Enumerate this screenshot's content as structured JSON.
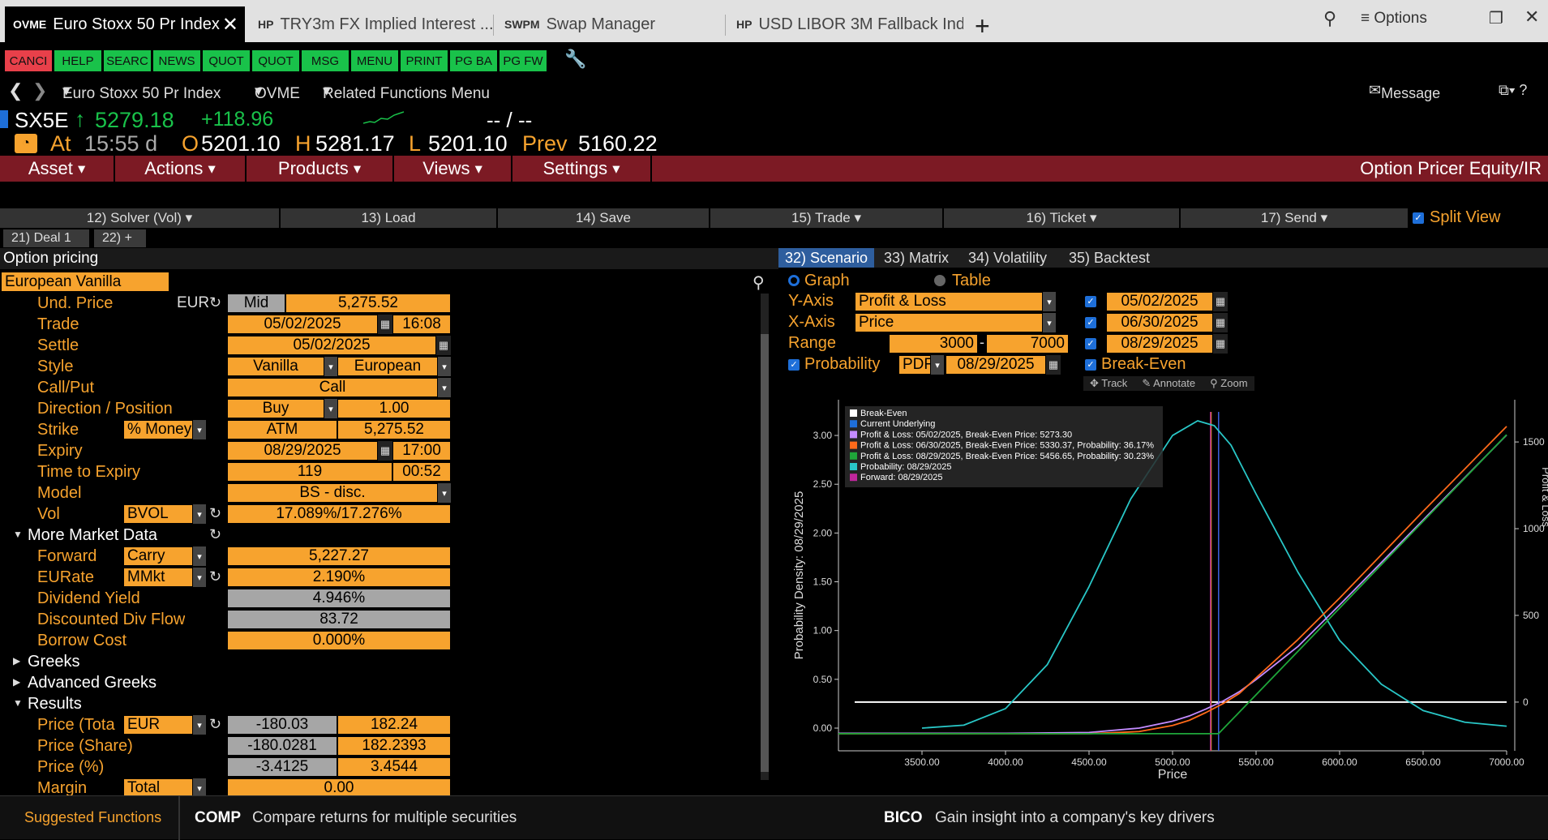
{
  "tabs": [
    {
      "code": "OVME",
      "title": "Euro Stoxx 50 Pr Index",
      "active": true
    },
    {
      "code": "HP",
      "title": "TRY3m FX Implied Interest ..."
    },
    {
      "code": "SWPM",
      "title": "Swap Manager"
    },
    {
      "code": "HP",
      "title": "USD LIBOR 3M Fallback Ind..."
    }
  ],
  "window": {
    "options_label": "Options",
    "new_tab": "+"
  },
  "function_keys": [
    {
      "label": "CANCI",
      "color": "#e8404a"
    },
    {
      "label": "HELP",
      "color": "#19c24a"
    },
    {
      "label": "SEARC",
      "color": "#19c24a"
    },
    {
      "label": "NEWS",
      "color": "#19c24a"
    },
    {
      "label": "QUOT",
      "color": "#19c24a"
    },
    {
      "label": "QUOT",
      "color": "#19c24a"
    },
    {
      "label": "MSG",
      "color": "#19c24a"
    },
    {
      "label": "MENU",
      "color": "#19c24a"
    },
    {
      "label": "PRINT",
      "color": "#19c24a"
    },
    {
      "label": "PG BA",
      "color": "#19c24a"
    },
    {
      "label": "PG FW",
      "color": "#19c24a"
    }
  ],
  "nav": {
    "security": "Euro Stoxx 50 Pr Index",
    "function": "OVME",
    "related": "Related Functions Menu",
    "message": "Message"
  },
  "quote": {
    "ticker": "SX5E",
    "last": "5279.18",
    "change": "+118.96",
    "bidask": "-- / --",
    "at_label": "At",
    "time": "15:55 d",
    "open_label": "O",
    "open": "5201.10",
    "high_label": "H",
    "high": "5281.17",
    "low_label": "L",
    "low": "5201.10",
    "prev_label": "Prev",
    "prev": "5160.22"
  },
  "menubar": {
    "items": [
      "Asset",
      "Actions",
      "Products",
      "Views",
      "Settings"
    ],
    "title": "Option Pricer Equity/IR"
  },
  "actions": [
    "12) Solver (Vol)",
    "13) Load",
    "14) Save",
    "15) Trade",
    "16) Ticket",
    "17) Send"
  ],
  "split_view": "Split View",
  "deal_tabs": [
    "21) Deal 1",
    "22) +"
  ],
  "left": {
    "section": "Option pricing",
    "product": "European Vanilla",
    "und_price": {
      "label": "Und. Price",
      "ccy": "EUR",
      "side": "Mid",
      "value": "5,275.52"
    },
    "trade": {
      "label": "Trade",
      "date": "05/02/2025",
      "time": "16:08"
    },
    "settle": {
      "label": "Settle",
      "date": "05/02/2025"
    },
    "style": {
      "label": "Style",
      "a": "Vanilla",
      "b": "European"
    },
    "callput": {
      "label": "Call/Put",
      "value": "Call"
    },
    "direction": {
      "label": "Direction / Position",
      "a": "Buy",
      "b": "1.00"
    },
    "strike": {
      "label": "Strike",
      "mode": "% Money",
      "a": "ATM",
      "b": "5,275.52"
    },
    "expiry": {
      "label": "Expiry",
      "date": "08/29/2025",
      "time": "17:00"
    },
    "tte": {
      "label": "Time to Expiry",
      "days": "119",
      "time": "00:52"
    },
    "model": {
      "label": "Model",
      "value": "BS - disc."
    },
    "vol": {
      "label": "Vol",
      "source": "BVOL",
      "value": "17.089%/17.276%"
    },
    "more": "More Market Data",
    "forward": {
      "label": "Forward",
      "mode": "Carry",
      "value": "5,227.27"
    },
    "eurate": {
      "label": "EURate",
      "mode": "MMkt",
      "value": "2.190%"
    },
    "divyield": {
      "label": "Dividend Yield",
      "value": "4.946%"
    },
    "divflow": {
      "label": "Discounted Div Flow",
      "value": "83.72"
    },
    "borrow": {
      "label": "Borrow Cost",
      "value": "0.000%"
    },
    "greeks": "Greeks",
    "adv_greeks": "Advanced Greeks",
    "results": "Results",
    "price_total": {
      "label": "Price (Tota",
      "ccy": "EUR",
      "a": "-180.03",
      "b": "182.24"
    },
    "price_share": {
      "label": "Price (Share)",
      "a": "-180.0281",
      "b": "182.2393"
    },
    "price_pct": {
      "label": "Price (%)",
      "a": "-3.4125",
      "b": "3.4544"
    },
    "margin": {
      "label": "Margin",
      "mode": "Total",
      "value": "0.00"
    }
  },
  "right": {
    "tabs": [
      "32) Scenario",
      "33) Matrix",
      "34) Volatility",
      "35) Backtest"
    ],
    "graph": "Graph",
    "table": "Table",
    "yaxis": {
      "label": "Y-Axis",
      "value": "Profit & Loss"
    },
    "xaxis": {
      "label": "X-Axis",
      "value": "Price"
    },
    "range": {
      "label": "Range",
      "from": "3000",
      "to": "7000"
    },
    "dates": [
      "05/02/2025",
      "06/30/2025",
      "08/29/2025"
    ],
    "probability": {
      "label": "Probability",
      "mode": "PDF",
      "date": "08/29/2025"
    },
    "breakeven": "Break-Even",
    "chart_tools": [
      "Track",
      "Annotate",
      "Zoom"
    ]
  },
  "chart_data": {
    "type": "line",
    "xlabel": "Price",
    "ylabel": "Probability Density: 08/29/2025",
    "y2label": "Profit & Loss",
    "xlim": [
      3000,
      7000
    ],
    "ylim": [
      0,
      3.2
    ],
    "y2lim": [
      -150,
      1650
    ],
    "x_ticks": [
      "3500.00",
      "4000.00",
      "4500.00",
      "5000.00",
      "5500.00",
      "6000.00",
      "6500.00",
      "7000.00"
    ],
    "y_ticks": [
      "0.00",
      "0.50",
      "1.00",
      "1.50",
      "2.00",
      "2.50",
      "3.00"
    ],
    "y2_ticks": [
      "0",
      "500",
      "1000",
      "1500"
    ],
    "legend": [
      {
        "name": "Break-Even",
        "color": "#ffffff"
      },
      {
        "name": "Current Underlying",
        "color": "#1e6fd9"
      },
      {
        "name": "Profit & Loss: 05/02/2025, Break-Even Price: 5273.30",
        "color": "#c38bff"
      },
      {
        "name": "Profit & Loss: 06/30/2025, Break-Even Price: 5330.37, Probability: 36.17%",
        "color": "#ff6a1a"
      },
      {
        "name": "Profit & Loss: 08/29/2025, Break-Even Price: 5456.65, Probability: 30.23%",
        "color": "#1fa63a"
      },
      {
        "name": "Probability: 08/29/2025",
        "color": "#29c7c7"
      },
      {
        "name": "Forward: 08/29/2025",
        "color": "#c0279c"
      }
    ],
    "series": [
      {
        "name": "Probability: 08/29/2025",
        "axis": "left",
        "color": "#29c7c7",
        "x": [
          3500,
          3750,
          4000,
          4250,
          4500,
          4750,
          5000,
          5150,
          5250,
          5350,
          5500,
          5750,
          6000,
          6250,
          6500,
          6750,
          7000
        ],
        "values": [
          0.0,
          0.03,
          0.2,
          0.65,
          1.45,
          2.35,
          3.0,
          3.15,
          3.1,
          2.9,
          2.4,
          1.6,
          0.9,
          0.45,
          0.18,
          0.06,
          0.02
        ]
      },
      {
        "name": "Profit & Loss: 05/02/2025",
        "axis": "right",
        "color": "#c38bff",
        "x": [
          3000,
          4000,
          4500,
          4800,
          5000,
          5100,
          5200,
          5300,
          5400,
          5500,
          5750,
          6000,
          6500,
          7000
        ],
        "values": [
          -180,
          -180,
          -175,
          -150,
          -110,
          -80,
          -40,
          5,
          60,
          130,
          320,
          560,
          1050,
          1540
        ]
      },
      {
        "name": "Profit & Loss: 06/30/2025",
        "axis": "right",
        "color": "#ff6a1a",
        "x": [
          3000,
          4500,
          4800,
          5000,
          5100,
          5200,
          5300,
          5400,
          5500,
          5750,
          6000,
          6500,
          7000
        ],
        "values": [
          -182,
          -182,
          -170,
          -135,
          -105,
          -60,
          -10,
          50,
          140,
          360,
          600,
          1100,
          1590
        ]
      },
      {
        "name": "Profit & Loss: 08/29/2025",
        "axis": "right",
        "color": "#1fa63a",
        "x": [
          3000,
          5275,
          5500,
          6000,
          6500,
          7000
        ],
        "values": [
          -182,
          -182,
          42,
          542,
          1042,
          1542
        ]
      }
    ],
    "breakeven_line": 0,
    "current_underlying": 5275.52,
    "forward_line": 5227.27
  },
  "bottom": {
    "label": "Suggested Functions",
    "f1_code": "COMP",
    "f1_desc": "Compare returns for multiple securities",
    "f2_code": "BICO",
    "f2_desc": "Gain insight into a company's key drivers"
  }
}
